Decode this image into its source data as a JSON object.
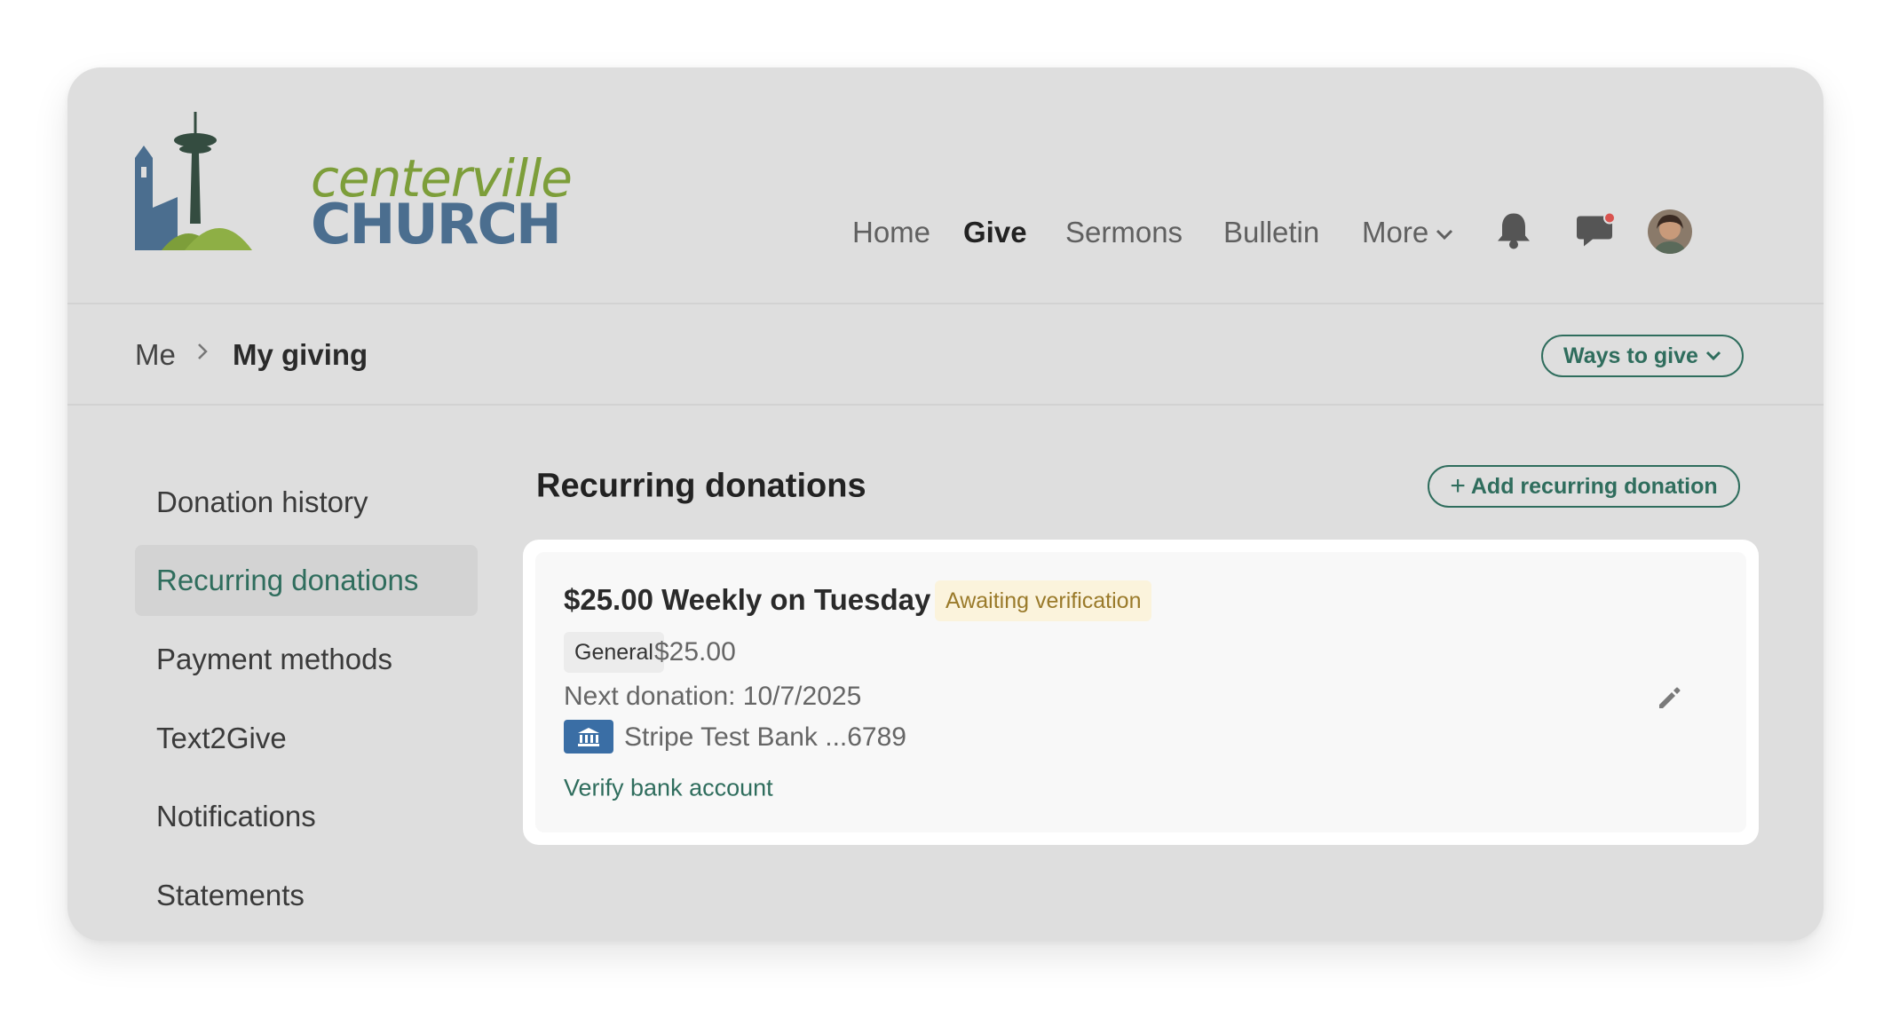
{
  "logo": {
    "line1": "centerville",
    "line2": "CHURCH"
  },
  "nav": {
    "items": [
      {
        "label": "Home"
      },
      {
        "label": "Give"
      },
      {
        "label": "Sermons"
      },
      {
        "label": "Bulletin"
      },
      {
        "label": "More"
      }
    ],
    "active": "Give",
    "icons": [
      "chevron-down-icon",
      "bell-icon",
      "messages-icon",
      "avatar"
    ],
    "notification_dot_color": "#d9534f"
  },
  "breadcrumb": {
    "parent": "Me",
    "current": "My giving"
  },
  "ways_to_give": {
    "label": "Ways to give"
  },
  "sidebar": {
    "items": [
      {
        "label": "Donation history"
      },
      {
        "label": "Recurring donations"
      },
      {
        "label": "Payment methods"
      },
      {
        "label": "Text2Give"
      },
      {
        "label": "Notifications"
      },
      {
        "label": "Statements"
      }
    ],
    "active": "Recurring donations"
  },
  "main": {
    "title": "Recurring donations",
    "add_button": "Add recurring donation"
  },
  "donation": {
    "title": "$25.00 Weekly on Tuesday",
    "status": "Awaiting verification",
    "fund": "General",
    "amount": "$25.00",
    "next": "Next donation: 10/7/2025",
    "bank": "Stripe Test Bank ...6789",
    "verify_link": "Verify bank account"
  },
  "colors": {
    "accent": "#2f6d5d",
    "logo_green": "#7d9e3a",
    "logo_blue": "#4b6e8f",
    "status_bg": "#fbf3dc",
    "status_text": "#9a7a2a",
    "bank_icon": "#3a6ea5"
  }
}
